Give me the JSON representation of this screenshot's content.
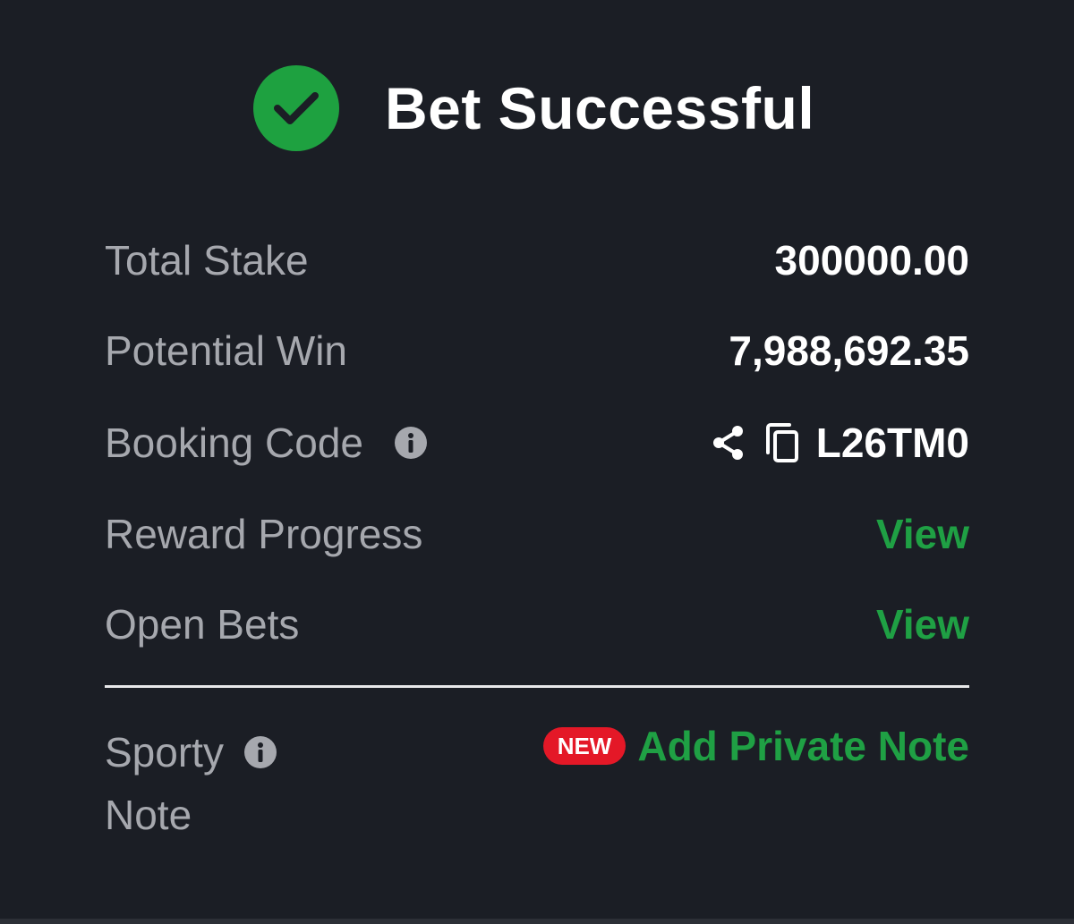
{
  "header": {
    "title": "Bet Successful",
    "icon": "check-circle-icon",
    "accent_color": "#1ea140"
  },
  "rows": {
    "total_stake": {
      "label": "Total Stake",
      "value": "300000.00"
    },
    "potential_win": {
      "label": "Potential Win",
      "value": "7,988,692.35"
    },
    "booking_code": {
      "label": "Booking Code",
      "value": "L26TM0"
    },
    "reward_progress": {
      "label": "Reward Progress",
      "action": "View"
    },
    "open_bets": {
      "label": "Open Bets",
      "action": "View"
    }
  },
  "note": {
    "label_line1": "Sporty",
    "label_line2": "Note",
    "badge": "NEW",
    "action": "Add Private Note"
  },
  "colors": {
    "background": "#1b1e25",
    "label": "#a6a8ae",
    "link": "#1fa044",
    "badge": "#e41827"
  }
}
